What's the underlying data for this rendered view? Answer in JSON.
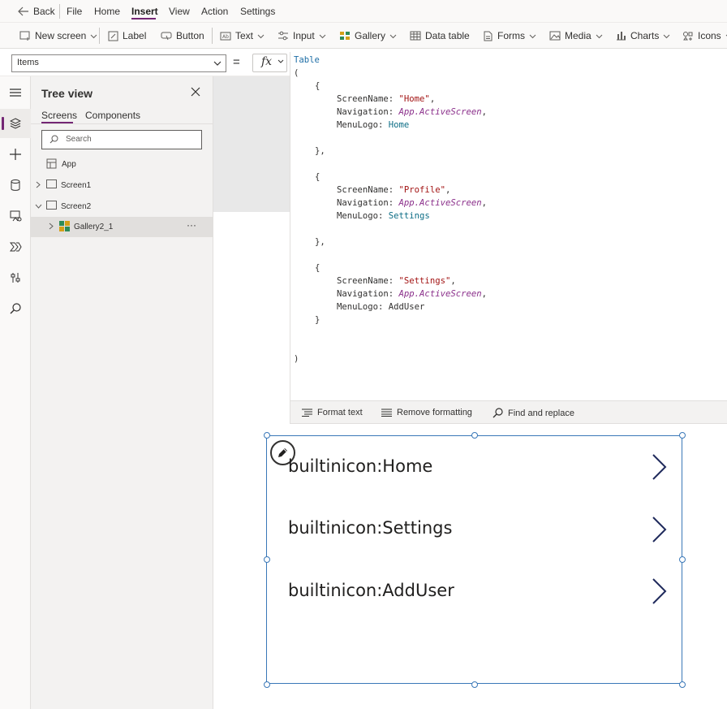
{
  "menubar": {
    "back_label": "Back",
    "items": [
      "File",
      "Home",
      "Insert",
      "View",
      "Action",
      "Settings"
    ],
    "active": "Insert"
  },
  "ribbon": {
    "new_screen": "New screen",
    "label": "Label",
    "button": "Button",
    "text": "Text",
    "input": "Input",
    "gallery": "Gallery",
    "data_table": "Data table",
    "forms": "Forms",
    "media": "Media",
    "charts": "Charts",
    "icons": "Icons"
  },
  "formula": {
    "property": "Items",
    "equals": "=",
    "fx": "fx"
  },
  "tree": {
    "title": "Tree view",
    "tabs": [
      "Screens",
      "Components"
    ],
    "search_placeholder": "Search",
    "items": [
      {
        "label": "App"
      },
      {
        "label": "Screen1"
      },
      {
        "label": "Screen2"
      },
      {
        "label": "Gallery2_1"
      }
    ],
    "more": "···"
  },
  "code": {
    "keyword": "Table",
    "open_paren": "(",
    "close_paren": ")",
    "records": [
      {
        "screen_key": "ScreenName: ",
        "screen_val": "\"Home\"",
        "nav_key": "Navigation: ",
        "nav_val": "App.ActiveScreen",
        "logo_key": "MenuLogo: ",
        "logo_val": "Home"
      },
      {
        "screen_key": "ScreenName: ",
        "screen_val": "\"Profile\"",
        "nav_key": "Navigation: ",
        "nav_val": "App.ActiveScreen",
        "logo_key": "MenuLogo: ",
        "logo_val": "Settings"
      },
      {
        "screen_key": "ScreenName: ",
        "screen_val": "\"Settings\"",
        "nav_key": "Navigation: ",
        "nav_val": "App.ActiveScreen",
        "logo_key": "MenuLogo: ",
        "logo_val": "AddUser"
      }
    ]
  },
  "editor_bar": {
    "format_text": "Format text",
    "remove_formatting": "Remove formatting",
    "find_replace": "Find and replace"
  },
  "gallery": {
    "items": [
      "builtinicon:Home",
      "builtinicon:Settings",
      "builtinicon:AddUser"
    ]
  },
  "colors": {
    "accent": "#742774",
    "selection": "#3a78b8"
  }
}
